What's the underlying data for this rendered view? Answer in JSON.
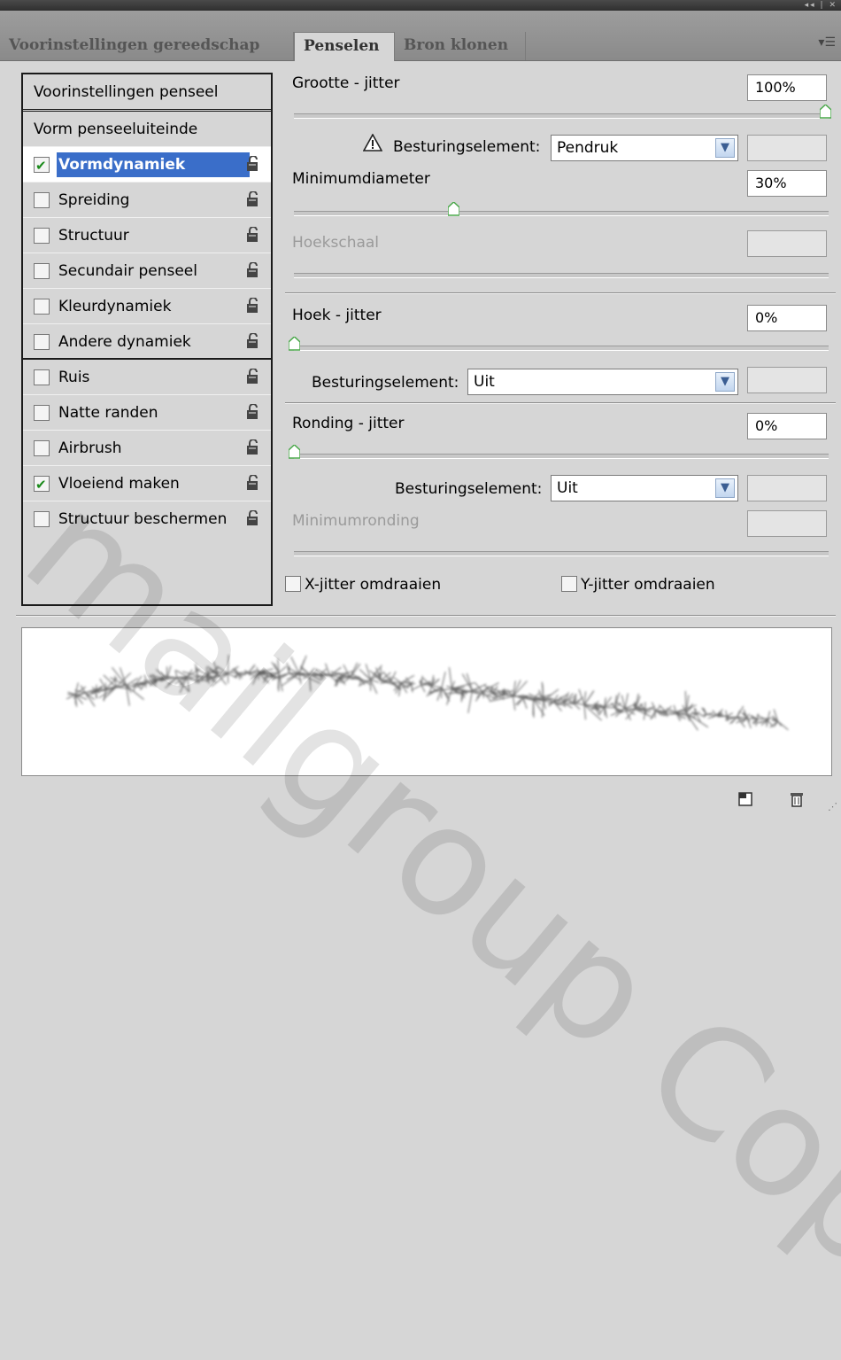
{
  "tabs": [
    {
      "label": "Voorinstellingen gereedschap",
      "active": false
    },
    {
      "label": "Penselen",
      "active": true
    },
    {
      "label": "Bron klonen",
      "active": false
    }
  ],
  "sidebar": {
    "header": "Voorinstellingen penseel",
    "items": [
      {
        "label": "Vorm penseeluiteinde",
        "checkbox": false,
        "checked": false,
        "lock": false
      },
      {
        "label": "Vormdynamiek",
        "checkbox": true,
        "checked": true,
        "lock": true,
        "selected": true
      },
      {
        "label": "Spreiding",
        "checkbox": true,
        "checked": false,
        "lock": true
      },
      {
        "label": "Structuur",
        "checkbox": true,
        "checked": false,
        "lock": true
      },
      {
        "label": "Secundair penseel",
        "checkbox": true,
        "checked": false,
        "lock": true
      },
      {
        "label": "Kleurdynamiek",
        "checkbox": true,
        "checked": false,
        "lock": true
      },
      {
        "label": "Andere dynamiek",
        "checkbox": true,
        "checked": false,
        "lock": true
      },
      {
        "label": "Ruis",
        "checkbox": true,
        "checked": false,
        "lock": true
      },
      {
        "label": "Natte randen",
        "checkbox": true,
        "checked": false,
        "lock": true
      },
      {
        "label": "Airbrush",
        "checkbox": true,
        "checked": false,
        "lock": true
      },
      {
        "label": "Vloeiend maken",
        "checkbox": true,
        "checked": true,
        "lock": true
      },
      {
        "label": "Structuur beschermen",
        "checkbox": true,
        "checked": false,
        "lock": true
      }
    ]
  },
  "controls": {
    "size_jitter": {
      "label": "Grootte - jitter",
      "value": "100%",
      "level": 1.0
    },
    "control1": {
      "label": "Besturingselement:",
      "value": "Pendruk",
      "warning_icon": "warning-triangle-icon"
    },
    "min_diameter": {
      "label": "Minimumdiameter",
      "value": "30%",
      "level": 0.3
    },
    "tilt_scale": {
      "label": "Hoekschaal",
      "disabled": true
    },
    "angle_jitter": {
      "label": "Hoek - jitter",
      "value": "0%",
      "level": 0
    },
    "control2": {
      "label": "Besturingselement:",
      "value": "Uit"
    },
    "roundness_jitter": {
      "label": "Ronding - jitter",
      "value": "0%",
      "level": 0
    },
    "control3": {
      "label": "Besturingselement:",
      "value": "Uit"
    },
    "min_roundness": {
      "label": "Minimumronding",
      "disabled": true
    },
    "flip_x": {
      "label": "X-jitter omdraaien",
      "checked": false
    },
    "flip_y": {
      "label": "Y-jitter omdraaien",
      "checked": false
    }
  },
  "watermark": "mailgroup Copy",
  "icons": {
    "new_brush": "new-brush-icon",
    "delete": "trash-icon",
    "menu": "panel-menu-icon"
  }
}
